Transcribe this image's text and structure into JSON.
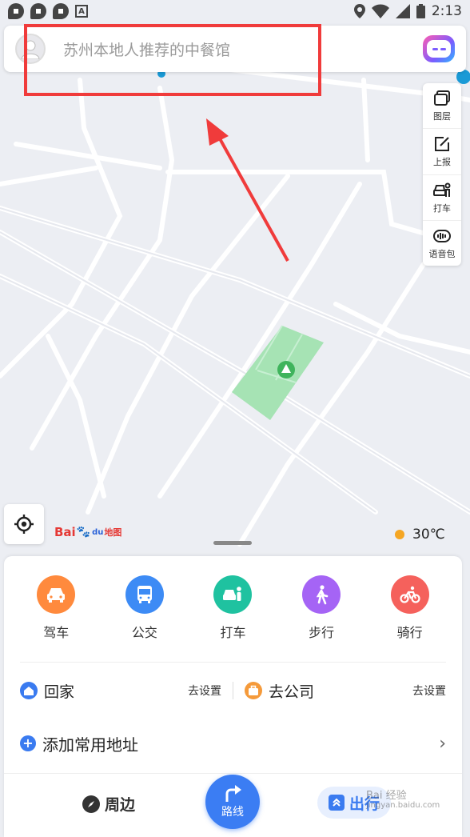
{
  "status_bar": {
    "time": "2:13",
    "notification_icons": [
      "chat-bubble-icon",
      "chat-bubble-icon",
      "chat-bubble-icon",
      "a-square-icon"
    ],
    "system_icons": [
      "location-icon",
      "wifi-icon",
      "signal-icon",
      "battery-icon"
    ]
  },
  "search": {
    "placeholder": "苏州本地人推荐的中餐馆",
    "avatar_icon": "user-avatar-icon",
    "assistant_icon": "voice-assistant-icon"
  },
  "map_tools": [
    {
      "label": "图层",
      "icon": "layers-icon"
    },
    {
      "label": "上报",
      "icon": "report-edit-icon"
    },
    {
      "label": "打车",
      "icon": "taxi-icon"
    },
    {
      "label": "语音包",
      "icon": "voice-pack-icon"
    }
  ],
  "map": {
    "logo_text_1": "Bai",
    "logo_text_2": "du",
    "logo_text_3": "地图",
    "temperature": "30℃",
    "park_color": "#a6e3b4"
  },
  "transport_modes": [
    {
      "label": "驾车",
      "icon": "car-icon",
      "color": "#ff8a3d"
    },
    {
      "label": "公交",
      "icon": "bus-icon",
      "color": "#3d8bf5"
    },
    {
      "label": "打车",
      "icon": "taxi-icon",
      "color": "#1fc2a0"
    },
    {
      "label": "步行",
      "icon": "walk-icon",
      "color": "#a564f5"
    },
    {
      "label": "骑行",
      "icon": "bike-icon",
      "color": "#f5615c"
    }
  ],
  "favorites": {
    "home_label": "回家",
    "home_action": "去设置",
    "company_label": "去公司",
    "company_action": "去设置",
    "add_label": "添加常用地址"
  },
  "bottom_nav": {
    "nearby": "周边",
    "route": "路线",
    "travel": "出行"
  },
  "watermark": {
    "line1": "Bai 经验",
    "line2": "jingyan.baidu.com"
  },
  "annotation": {
    "highlight_color": "#f03b3b"
  }
}
